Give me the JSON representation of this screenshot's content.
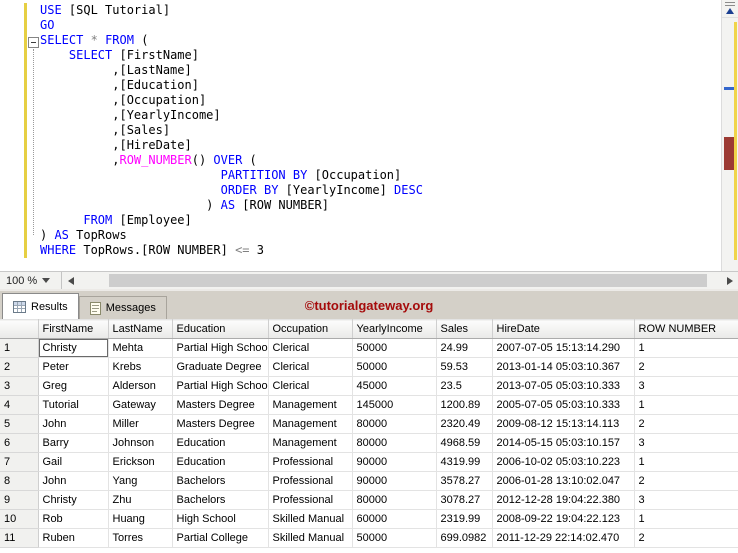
{
  "editor": {
    "zoom_level": "100 %",
    "lines": [
      [
        {
          "c": "kw",
          "t": "USE"
        },
        {
          "c": "pl",
          "t": " [SQL Tutorial]"
        }
      ],
      [
        {
          "c": "kw",
          "t": "GO"
        }
      ],
      [
        {
          "c": "kw",
          "t": "SELECT"
        },
        {
          "c": "pl",
          "t": " "
        },
        {
          "c": "op",
          "t": "*"
        },
        {
          "c": "pl",
          "t": " "
        },
        {
          "c": "kw",
          "t": "FROM"
        },
        {
          "c": "pl",
          "t": " ("
        }
      ],
      [
        {
          "c": "pl",
          "t": "    "
        },
        {
          "c": "kw",
          "t": "SELECT"
        },
        {
          "c": "pl",
          "t": " [FirstName]"
        }
      ],
      [
        {
          "c": "pl",
          "t": "          ,[LastName]"
        }
      ],
      [
        {
          "c": "pl",
          "t": "          ,[Education]"
        }
      ],
      [
        {
          "c": "pl",
          "t": "          ,[Occupation]"
        }
      ],
      [
        {
          "c": "pl",
          "t": "          ,[YearlyIncome]"
        }
      ],
      [
        {
          "c": "pl",
          "t": "          ,[Sales]"
        }
      ],
      [
        {
          "c": "pl",
          "t": "          ,[HireDate]"
        }
      ],
      [
        {
          "c": "pl",
          "t": "          ,"
        },
        {
          "c": "fn",
          "t": "ROW_NUMBER"
        },
        {
          "c": "pl",
          "t": "() "
        },
        {
          "c": "kw",
          "t": "OVER"
        },
        {
          "c": "pl",
          "t": " ("
        }
      ],
      [
        {
          "c": "pl",
          "t": "                         "
        },
        {
          "c": "kw",
          "t": "PARTITION BY"
        },
        {
          "c": "pl",
          "t": " [Occupation]"
        }
      ],
      [
        {
          "c": "pl",
          "t": "                         "
        },
        {
          "c": "kw",
          "t": "ORDER BY"
        },
        {
          "c": "pl",
          "t": " [YearlyIncome] "
        },
        {
          "c": "kw",
          "t": "DESC"
        }
      ],
      [
        {
          "c": "pl",
          "t": "                       ) "
        },
        {
          "c": "kw",
          "t": "AS"
        },
        {
          "c": "pl",
          "t": " [ROW NUMBER]"
        }
      ],
      [
        {
          "c": "pl",
          "t": "      "
        },
        {
          "c": "kw",
          "t": "FROM"
        },
        {
          "c": "pl",
          "t": " [Employee]"
        }
      ],
      [
        {
          "c": "pl",
          "t": ") "
        },
        {
          "c": "kw",
          "t": "AS"
        },
        {
          "c": "pl",
          "t": " TopRows"
        }
      ],
      [
        {
          "c": "kw",
          "t": "WHERE"
        },
        {
          "c": "pl",
          "t": " TopRows.[ROW NUMBER] "
        },
        {
          "c": "op",
          "t": "<="
        },
        {
          "c": "pl",
          "t": " 3"
        }
      ]
    ]
  },
  "colors": {
    "keyword": "#0000ff",
    "system_function": "#ff00ff",
    "operator": "#808080",
    "change_tracking_bar": "#e6cf43",
    "watermark": "#a50b0b"
  },
  "results": {
    "tabs": [
      {
        "label": "Results",
        "active": true
      },
      {
        "label": "Messages",
        "active": false
      }
    ],
    "watermark": "©tutorialgateway.org",
    "grid": {
      "columns": [
        "FirstName",
        "LastName",
        "Education",
        "Occupation",
        "YearlyIncome",
        "Sales",
        "HireDate",
        "ROW NUMBER"
      ],
      "selected": {
        "row_index": 0,
        "col_index": 0
      },
      "rows": [
        {
          "num": "1",
          "cells": [
            "Christy",
            "Mehta",
            "Partial High School",
            "Clerical",
            "50000",
            "24.99",
            "2007-07-05 15:13:14.290",
            "1"
          ]
        },
        {
          "num": "2",
          "cells": [
            "Peter",
            "Krebs",
            "Graduate Degree",
            "Clerical",
            "50000",
            "59.53",
            "2013-01-14 05:03:10.367",
            "2"
          ]
        },
        {
          "num": "3",
          "cells": [
            "Greg",
            "Alderson",
            "Partial High School",
            "Clerical",
            "45000",
            "23.5",
            "2013-07-05 05:03:10.333",
            "3"
          ]
        },
        {
          "num": "4",
          "cells": [
            "Tutorial",
            "Gateway",
            "Masters Degree",
            "Management",
            "145000",
            "1200.89",
            "2005-07-05 05:03:10.333",
            "1"
          ]
        },
        {
          "num": "5",
          "cells": [
            "John",
            "Miller",
            "Masters Degree",
            "Management",
            "80000",
            "2320.49",
            "2009-08-12 15:13:14.113",
            "2"
          ]
        },
        {
          "num": "6",
          "cells": [
            "Barry",
            "Johnson",
            "Education",
            "Management",
            "80000",
            "4968.59",
            "2014-05-15 05:03:10.157",
            "3"
          ]
        },
        {
          "num": "7",
          "cells": [
            "Gail",
            "Erickson",
            "Education",
            "Professional",
            "90000",
            "4319.99",
            "2006-10-02 05:03:10.223",
            "1"
          ]
        },
        {
          "num": "8",
          "cells": [
            "John",
            "Yang",
            "Bachelors",
            "Professional",
            "90000",
            "3578.27",
            "2006-01-28 13:10:02.047",
            "2"
          ]
        },
        {
          "num": "9",
          "cells": [
            "Christy",
            "Zhu",
            "Bachelors",
            "Professional",
            "80000",
            "3078.27",
            "2012-12-28 19:04:22.380",
            "3"
          ]
        },
        {
          "num": "10",
          "cells": [
            "Rob",
            "Huang",
            "High School",
            "Skilled Manual",
            "60000",
            "2319.99",
            "2008-09-22 19:04:22.123",
            "1"
          ]
        },
        {
          "num": "11",
          "cells": [
            "Ruben",
            "Torres",
            "Partial College",
            "Skilled Manual",
            "50000",
            "699.0982",
            "2011-12-29 22:14:02.470",
            "2"
          ]
        }
      ]
    }
  }
}
